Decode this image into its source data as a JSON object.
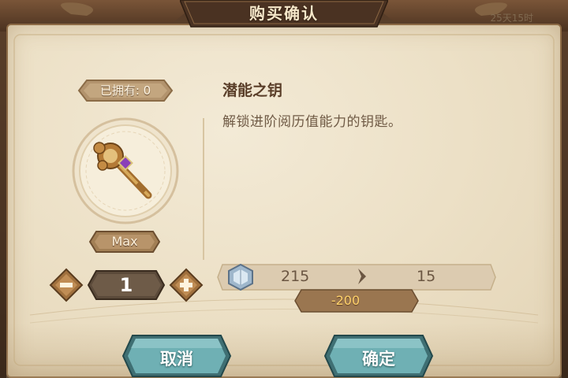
{
  "dialog": {
    "title": "购买确认",
    "timer": "25天15时"
  },
  "item": {
    "owned_label": "已拥有: 0",
    "name": "潜能之钥",
    "description": "解锁进阶阅历值能力的钥匙。",
    "icon": "ornate-key-icon"
  },
  "quantity": {
    "max_label": "Max",
    "value": "1",
    "minus_icon": "minus-icon",
    "plus_icon": "plus-icon"
  },
  "currency": {
    "icon": "silver-crystal-icon",
    "before": "215",
    "after": "15",
    "cost": "-200"
  },
  "buttons": {
    "cancel_label": "取消",
    "confirm_label": "确定"
  },
  "colors": {
    "parchment": "#ece0c6",
    "wood_frame": "#5a3f2a",
    "teal_button": "#6fb0b4",
    "cost_gold": "#ffd26b"
  }
}
